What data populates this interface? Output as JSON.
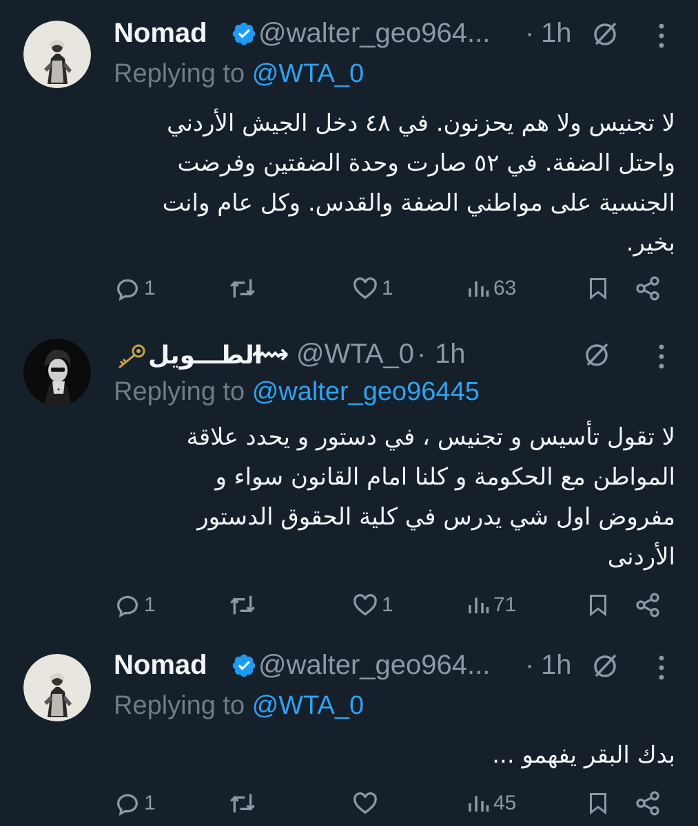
{
  "tweets": [
    {
      "name": "Nomad",
      "verified": true,
      "handle": "@walter_geo964...",
      "dot": "·",
      "time": "1h",
      "replying_label": "Replying to",
      "replying_to": "@WTA_0",
      "text_lines": [
        "لا تجنيس ولا هم يحزنون. في ٤٨ دخل الجيش الأردني",
        "واحتل الضفة. في ٥٢ صارت وحدة الضفتين وفرضت",
        "الجنسية على مواطني الضفة والقدس. وكل عام وانت",
        "بخير."
      ],
      "actions": {
        "replies": "1",
        "retweets": "",
        "likes": "1",
        "views": "63"
      }
    },
    {
      "name": "الطـــويل",
      "name_decoration": "⟿",
      "verified": false,
      "handle": "@WTA_0",
      "dot": "·",
      "time": "1h",
      "replying_label": "Replying to",
      "replying_to": "@walter_geo96445",
      "text_lines": [
        "لا تقول تأسيس و تجنيس ، في دستور و يحدد علاقة",
        "المواطن مع الحكومة و كلنا امام القانون سواء و",
        "مفروض اول شي يدرس في كلية الحقوق الدستور",
        "الأردنى"
      ],
      "actions": {
        "replies": "1",
        "retweets": "",
        "likes": "1",
        "views": "71"
      }
    },
    {
      "name": "Nomad",
      "verified": true,
      "handle": "@walter_geo964...",
      "dot": "·",
      "time": "1h",
      "replying_label": "Replying to",
      "replying_to": "@WTA_0",
      "text_lines": [
        "بدك البقر يفهمو ..."
      ],
      "actions": {
        "replies": "1",
        "retweets": "",
        "likes": "",
        "views": "45"
      }
    }
  ],
  "colors": {
    "background": "#16202b",
    "text": "#f2f4f5",
    "muted": "#8b98a5",
    "link": "#2ea3f2",
    "verified": "#1d9bf0"
  },
  "icons": [
    "verified-badge-icon",
    "no-entry-icon",
    "more-vertical-icon",
    "reply-icon",
    "retweet-icon",
    "like-icon",
    "views-icon",
    "bookmark-icon",
    "share-icon",
    "key-icon"
  ]
}
